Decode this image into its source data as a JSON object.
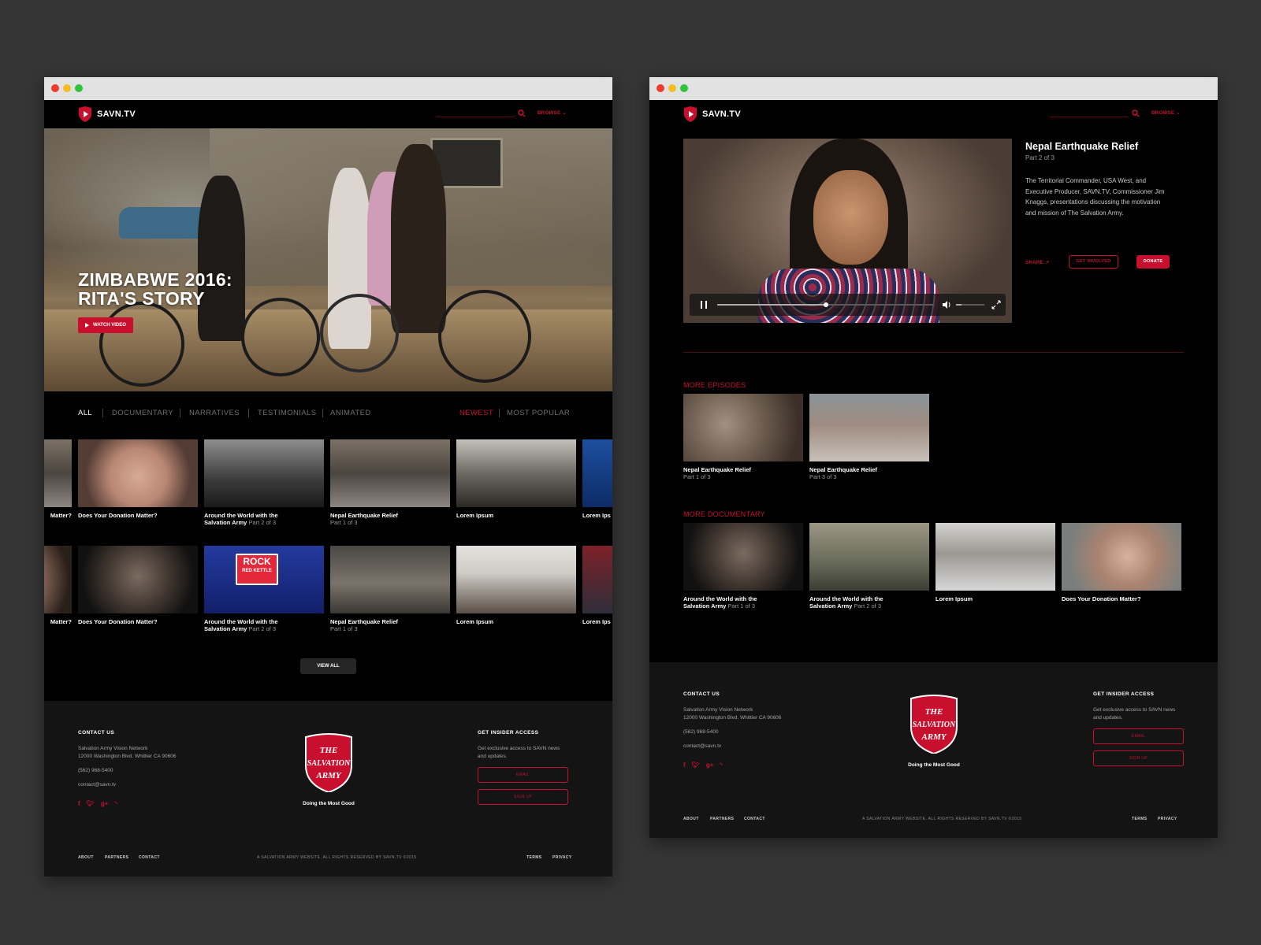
{
  "brand": {
    "name": "SAVN.TV",
    "accent": "#c8102e"
  },
  "left": {
    "nav": {
      "browse": "BROWSE"
    },
    "hero": {
      "title_line1": "ZIMBABWE 2016:",
      "title_line2": "RITA'S STORY",
      "button": "WATCH VIDEO"
    },
    "filters": {
      "categories": [
        "ALL",
        "DOCUMENTARY",
        "NARRATIVES",
        "TESTIMONIALS",
        "ANIMATED"
      ],
      "sort": [
        "NEWEST",
        "MOST POPULAR"
      ]
    },
    "row1": [
      {
        "title": "Matter?",
        "sub": ""
      },
      {
        "title": "Does Your Donation Matter?",
        "sub": ""
      },
      {
        "title": "Around the World with the Salvation Army",
        "sub": "Part 2 of 3"
      },
      {
        "title": "Nepal Earthquake Relief",
        "sub": "Part 1 of 3"
      },
      {
        "title": "Lorem Ipsum",
        "sub": ""
      },
      {
        "title": "Lorem Ips",
        "sub": ""
      }
    ],
    "row2": [
      {
        "title": "Matter?",
        "sub": ""
      },
      {
        "title": "Does Your Donation Matter?",
        "sub": ""
      },
      {
        "title": "Around the World with the Salvation Army",
        "sub": "Part 2 of 3"
      },
      {
        "title": "Nepal Earthquake Relief",
        "sub": "Part 1 of 3"
      },
      {
        "title": "Lorem Ipsum",
        "sub": ""
      },
      {
        "title": "Lorem Ips",
        "sub": ""
      }
    ],
    "rock_sign": {
      "line1": "ROCK",
      "line2": "RED KETTLE"
    },
    "view_all": "VIEW ALL"
  },
  "right": {
    "nav": {
      "browse": "BROWSE"
    },
    "episode": {
      "title": "Nepal Earthquake Relief",
      "part": "Part 2 of 3",
      "description": "The Territorial Commander, USA West, and Executive Producer, SAVN.TV, Commissioner Jim Knaggs, presentations discussing the motivation and mission of The Salvation Army.",
      "share": "SHARE",
      "get_involved": "GET INVOLVED",
      "donate": "DONATE",
      "progress": 0.5,
      "volume": 0.2
    },
    "more_episodes_label": "MORE EPISODES",
    "more_episodes": [
      {
        "title": "Nepal Earthquake Relief",
        "sub": "Part 1 of 3"
      },
      {
        "title": "Nepal Earthquake Relief",
        "sub": "Part 3 of 3"
      }
    ],
    "more_documentary_label": "MORE DOCUMENTARY",
    "more_documentary": [
      {
        "title": "Around the World with the Salvation Army",
        "sub": "Part 1 of 3"
      },
      {
        "title": "Around the World with the Salvation Army",
        "sub": "Part 2 of 3"
      },
      {
        "title": "Lorem Ipsum",
        "sub": ""
      },
      {
        "title": "Does Your Donation Matter?",
        "sub": ""
      }
    ]
  },
  "footer": {
    "contact_heading": "CONTACT US",
    "org": "Salvation Army Vision Network",
    "address": "12000 Washington Blvd. Whittier CA 90606",
    "phone": "(562) 968-5400",
    "email": "contact@savn.tv",
    "socials": [
      "f",
      "t",
      "g+",
      "rss"
    ],
    "logo_line1": "THE",
    "logo_line2": "SALVATION",
    "logo_line3": "ARMY",
    "tagline": "Doing the Most Good",
    "insider_heading": "GET INSIDER ACCESS",
    "insider_text": "Get exclusive access to SAVN news and updates.",
    "email_placeholder": "EMAIL",
    "signup": "SIGN UP",
    "links_left": [
      "ABOUT",
      "PARTNERS",
      "CONTACT"
    ],
    "copyright": "A SALVATION ARMY WEBSITE. ALL RIGHTS RESERVED BY SAVN.TV ©2015",
    "links_right": [
      "TERMS",
      "PRIVACY"
    ]
  }
}
